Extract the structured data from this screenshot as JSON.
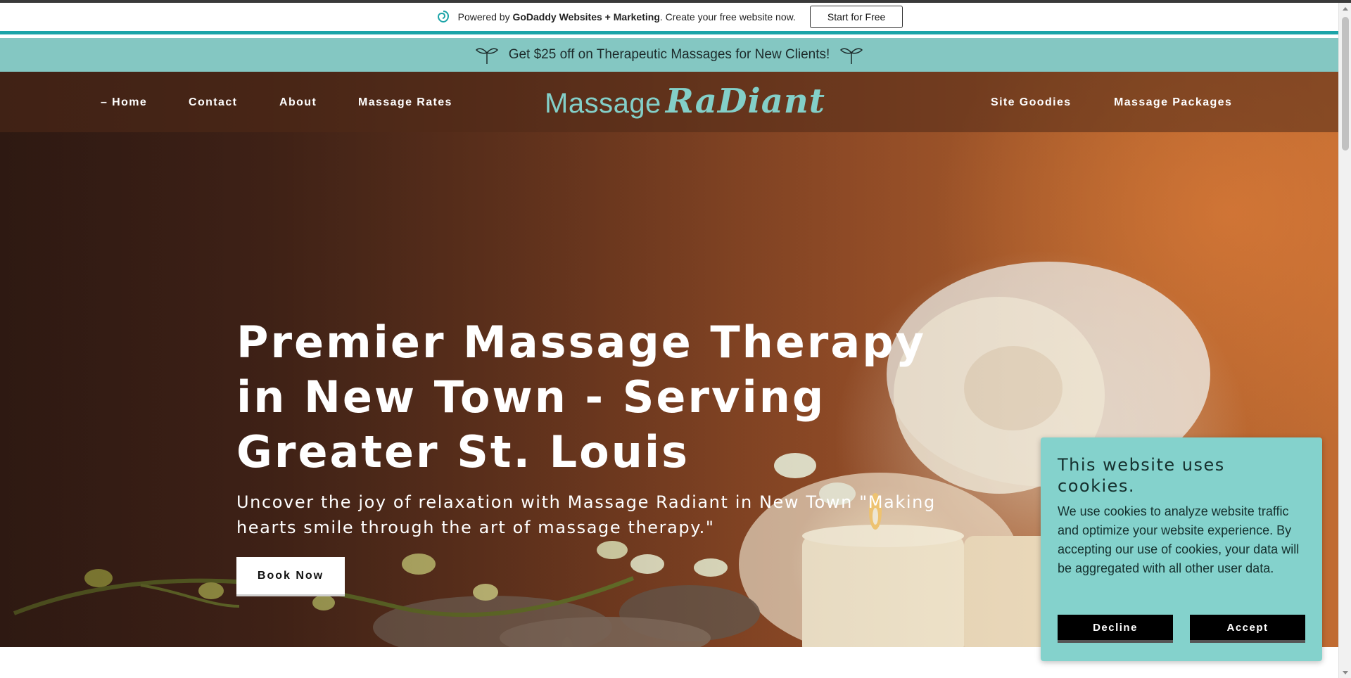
{
  "godaddy_bar": {
    "prefix": "Powered by",
    "brand": "GoDaddy Websites + Marketing",
    "suffix": ". Create your free website now.",
    "button_label": "Start for Free"
  },
  "promo": {
    "text": "Get $25 off on Therapeutic Massages for New Clients!"
  },
  "nav": {
    "left_items": [
      "– Home",
      "Contact",
      "About",
      "Massage Rates"
    ],
    "right_items": [
      "Site Goodies",
      "Massage Packages"
    ],
    "logo": {
      "part1": "Massage",
      "part2": "RaDiant"
    }
  },
  "hero": {
    "title": "Premier Massage Therapy in New Town - Serving Greater St. Louis",
    "subtitle": "Uncover the joy of relaxation with Massage Radiant in New Town \"Making hearts smile through the art of massage therapy.\"",
    "cta_label": "Book Now"
  },
  "cookie_banner": {
    "title": "This website uses cookies.",
    "body": "We use cookies to analyze website traffic and optimize your website experience. By accepting our use of cookies, your data will be aggregated with all other user data.",
    "decline_label": "Decline",
    "accept_label": "Accept"
  },
  "colors": {
    "teal_accent": "#1ba4a8",
    "promo_bg": "#84c7c2",
    "logo_teal": "#83cfc8",
    "cookie_bg": "#84d2cc"
  }
}
